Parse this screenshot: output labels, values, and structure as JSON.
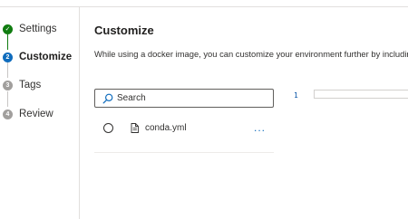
{
  "wizard": {
    "steps": [
      {
        "label": "Settings",
        "status": "complete",
        "marker": "✓"
      },
      {
        "label": "Customize",
        "status": "active",
        "marker": "2"
      },
      {
        "label": "Tags",
        "status": "pending",
        "marker": "3"
      },
      {
        "label": "Review",
        "status": "pending",
        "marker": "4"
      }
    ]
  },
  "main": {
    "title": "Customize",
    "description": "While using a docker image, you can customize your environment further by includin",
    "search": {
      "placeholder": "Search",
      "value": ""
    },
    "files": [
      {
        "name": "conda.yml",
        "selected": false,
        "icon": "document-icon",
        "more_label": "..."
      }
    ]
  },
  "editor": {
    "line_number": "1"
  },
  "colors": {
    "complete": "#107c10",
    "active": "#0f6cbd",
    "pending": "#a19f9d",
    "link": "#0f6cbd"
  }
}
